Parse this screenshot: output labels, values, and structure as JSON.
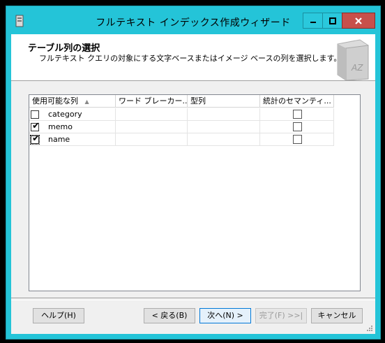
{
  "window": {
    "title": "フルテキスト インデックス作成ウィザード"
  },
  "header": {
    "title": "テーブル列の選択",
    "subtitle": "フルテキスト クエリの対象にする文字ベースまたはイメージ ベースの列を選択します。"
  },
  "grid": {
    "columns": [
      "使用可能な列",
      "ワード ブレーカー...",
      "型列",
      "統計のセマンティ..."
    ],
    "sort_indicator": "▲",
    "rows": [
      {
        "name": "category",
        "checked": false,
        "statistical_semantics": false
      },
      {
        "name": "memo",
        "checked": true,
        "statistical_semantics": false
      },
      {
        "name": "name",
        "checked": true,
        "statistical_semantics": false
      }
    ]
  },
  "buttons": {
    "help": "ヘルプ(H)",
    "back": "< 戻る(B)",
    "next": "次へ(N) >",
    "finish": "完了(F) >>|",
    "cancel": "キャンセル"
  },
  "colors": {
    "frame": "#24c4d8",
    "close": "#c7504b",
    "primary_border": "#0078d7"
  },
  "icons": [
    "app-icon",
    "minimize-icon",
    "maximize-icon",
    "close-icon",
    "book-icon",
    "checkbox-icon",
    "resize-grip-icon"
  ]
}
